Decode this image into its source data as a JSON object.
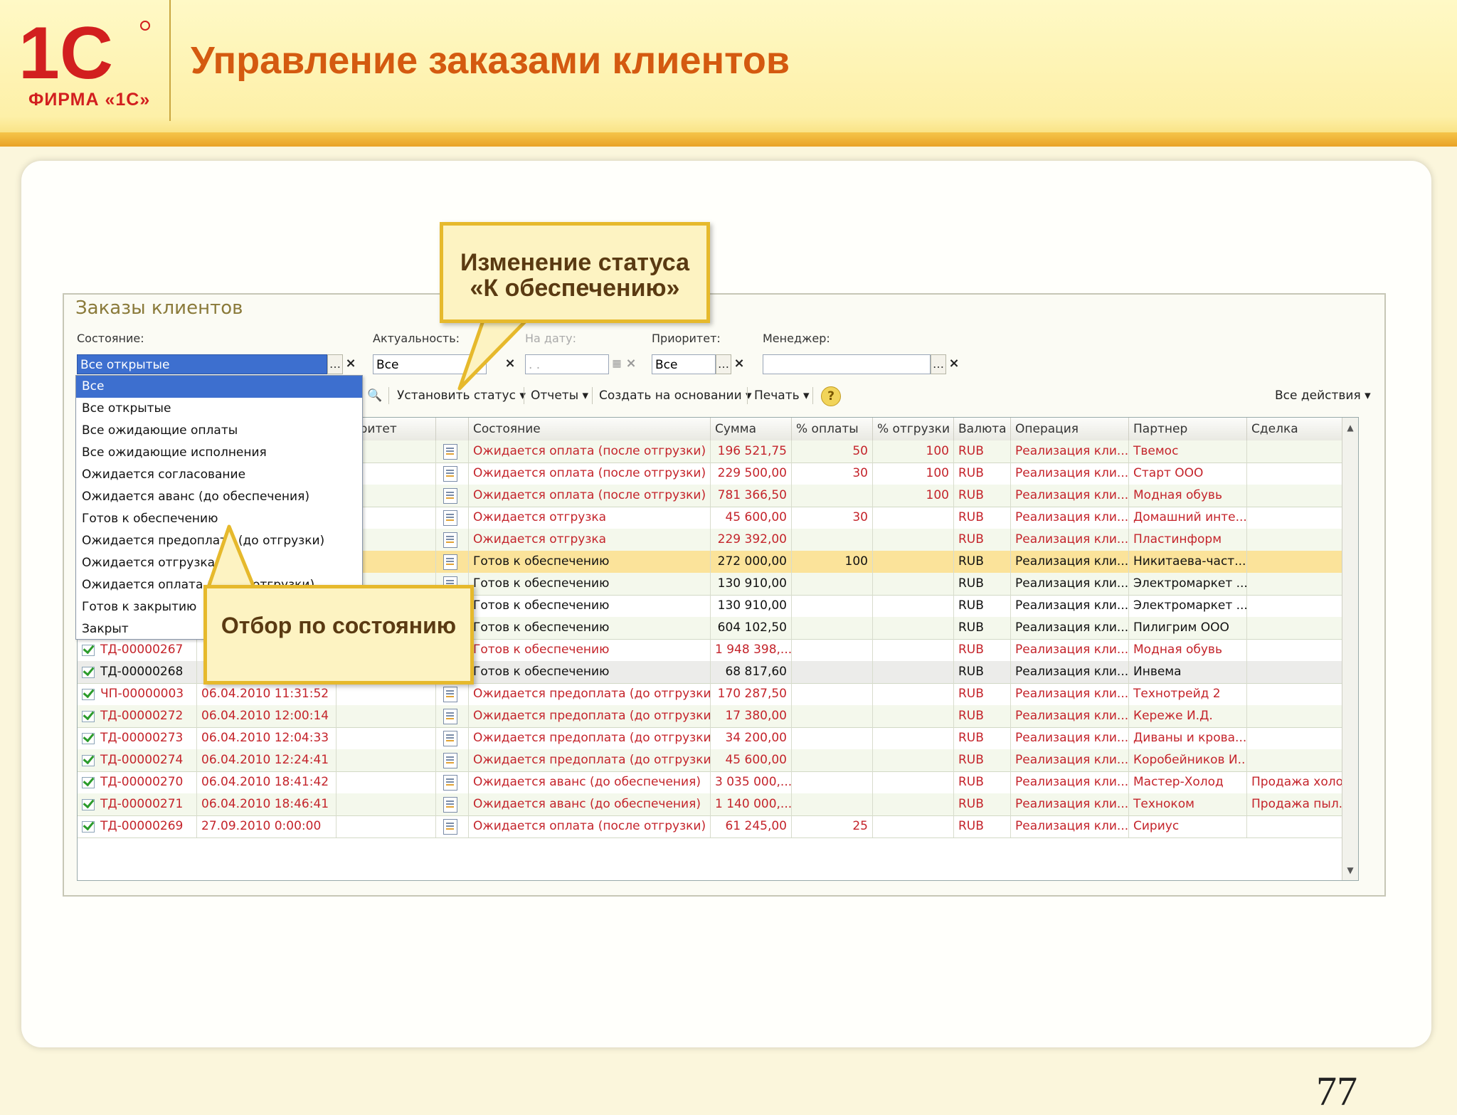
{
  "slide": {
    "title": "Управление заказами клиентов",
    "logo_text": "ФИРМА «1С»",
    "logo_mark": "1С",
    "page_number": "77",
    "accent_color": "#d45a10",
    "brand_color": "#d21f1f"
  },
  "window": {
    "title": "Заказы клиентов",
    "filters": {
      "state_label": "Состояние:",
      "state_value": "Все открытые",
      "relevance_label": "Актуальность:",
      "relevance_value": "Все",
      "date_label": "На дату:",
      "date_placeholder": ". .",
      "priority_label": "Приоритет:",
      "priority_value": "Все",
      "manager_label": "Менеджер:",
      "manager_value": ""
    },
    "toolbar": {
      "set_status": "Установить статус ▾",
      "reports": "Отчеты ▾",
      "create_based": "Создать на основании ▾",
      "print": "Печать ▾",
      "help": "?",
      "all_actions": "Все действия ▾"
    },
    "columns": [
      "",
      "",
      "...оритет",
      "",
      "Состояние",
      "Сумма",
      "% оплаты",
      "% отгрузки",
      "Валюта",
      "Операция",
      "Партнер",
      "Сделка"
    ],
    "rows": [
      {
        "num": "",
        "date": "",
        "state": "Ожидается оплата (после отгрузки)",
        "sum": "196 521,75",
        "pay": "50",
        "ship": "100",
        "cur": "RUB",
        "op": "Реализация кли...",
        "partner": "Твемос",
        "deal": "",
        "color": "red"
      },
      {
        "num": "",
        "date": "",
        "state": "Ожидается оплата (после отгрузки)",
        "sum": "229 500,00",
        "pay": "30",
        "ship": "100",
        "cur": "RUB",
        "op": "Реализация кли...",
        "partner": "Старт ООО",
        "deal": "",
        "color": "red"
      },
      {
        "num": "",
        "date": "",
        "state": "Ожидается оплата (после отгрузки)",
        "sum": "781 366,50",
        "pay": "",
        "ship": "100",
        "cur": "RUB",
        "op": "Реализация кли...",
        "partner": "Модная обувь",
        "deal": "",
        "color": "red"
      },
      {
        "num": "",
        "date": "",
        "state": "Ожидается отгрузка",
        "sum": "45 600,00",
        "pay": "30",
        "ship": "",
        "cur": "RUB",
        "op": "Реализация кли...",
        "partner": "Домашний инте...",
        "deal": "",
        "color": "red"
      },
      {
        "num": "",
        "date": "",
        "state": "Ожидается отгрузка",
        "sum": "229 392,00",
        "pay": "",
        "ship": "",
        "cur": "RUB",
        "op": "Реализация кли...",
        "partner": "Пластинформ",
        "deal": "",
        "color": "red"
      },
      {
        "num": "",
        "date": "",
        "state": "Готов к обеспечению",
        "sum": "272 000,00",
        "pay": "100",
        "ship": "",
        "cur": "RUB",
        "op": "Реализация кли...",
        "partner": "Никитаева-част...",
        "deal": "",
        "color": "black"
      },
      {
        "num": "",
        "date": "",
        "state": "Готов к обеспечению",
        "sum": "130 910,00",
        "pay": "",
        "ship": "",
        "cur": "RUB",
        "op": "Реализация кли...",
        "partner": "Электромаркет ...",
        "deal": "",
        "color": "black"
      },
      {
        "num": "",
        "date": "",
        "state": "Готов к обеспечению",
        "sum": "130 910,00",
        "pay": "",
        "ship": "",
        "cur": "RUB",
        "op": "Реализация кли...",
        "partner": "Электромаркет ...",
        "deal": "",
        "color": "black"
      },
      {
        "num": "",
        "date": "",
        "state": "Готов к обеспечению",
        "sum": "604 102,50",
        "pay": "",
        "ship": "",
        "cur": "RUB",
        "op": "Реализация кли...",
        "partner": "Пилигрим ООО",
        "deal": "",
        "color": "black"
      },
      {
        "num": "ТД-00000267",
        "date": "",
        "state": "Готов к обеспечению",
        "sum": "1 948 398,...",
        "pay": "",
        "ship": "",
        "cur": "RUB",
        "op": "Реализация кли...",
        "partner": "Модная обувь",
        "deal": "",
        "color": "red"
      },
      {
        "num": "ТД-00000268",
        "date": "",
        "state": "Готов к обеспечению",
        "sum": "68 817,60",
        "pay": "",
        "ship": "",
        "cur": "RUB",
        "op": "Реализация кли...",
        "partner": "Инвема",
        "deal": "",
        "color": "black"
      },
      {
        "num": "ЧП-00000003",
        "date": "06.04.2010 11:31:52",
        "state": "Ожидается предоплата (до отгрузки)",
        "sum": "170 287,50",
        "pay": "",
        "ship": "",
        "cur": "RUB",
        "op": "Реализация кли...",
        "partner": "Технотрейд 2",
        "deal": "",
        "color": "red"
      },
      {
        "num": "ТД-00000272",
        "date": "06.04.2010 12:00:14",
        "state": "Ожидается предоплата (до отгрузки)",
        "sum": "17 380,00",
        "pay": "",
        "ship": "",
        "cur": "RUB",
        "op": "Реализация кли...",
        "partner": "Кереже И.Д.",
        "deal": "",
        "color": "red"
      },
      {
        "num": "ТД-00000273",
        "date": "06.04.2010 12:04:33",
        "state": "Ожидается предоплата (до отгрузки)",
        "sum": "34 200,00",
        "pay": "",
        "ship": "",
        "cur": "RUB",
        "op": "Реализация кли...",
        "partner": "Диваны и крова...",
        "deal": "",
        "color": "red"
      },
      {
        "num": "ТД-00000274",
        "date": "06.04.2010 12:24:41",
        "state": "Ожидается предоплата (до отгрузки)",
        "sum": "45 600,00",
        "pay": "",
        "ship": "",
        "cur": "RUB",
        "op": "Реализация кли...",
        "partner": "Коробейников И...",
        "deal": "",
        "color": "red"
      },
      {
        "num": "ТД-00000270",
        "date": "06.04.2010 18:41:42",
        "state": "Ожидается аванс (до обеспечения)",
        "sum": "3 035 000,...",
        "pay": "",
        "ship": "",
        "cur": "RUB",
        "op": "Реализация кли...",
        "partner": "Мастер-Холод",
        "deal": "Продажа холо...",
        "color": "red"
      },
      {
        "num": "ТД-00000271",
        "date": "06.04.2010 18:46:41",
        "state": "Ожидается аванс (до обеспечения)",
        "sum": "1 140 000,...",
        "pay": "",
        "ship": "",
        "cur": "RUB",
        "op": "Реализация кли...",
        "partner": "Техноком",
        "deal": "Продажа пыл...",
        "color": "red"
      },
      {
        "num": "ТД-00000269",
        "date": "27.09.2010 0:00:00",
        "state": "Ожидается оплата (после отгрузки)",
        "sum": "61 245,00",
        "pay": "25",
        "ship": "",
        "cur": "RUB",
        "op": "Реализация кли...",
        "partner": "Сириус",
        "deal": "",
        "color": "red"
      }
    ],
    "dropdown_items": [
      "Все",
      "Все открытые",
      "Все ожидающие оплаты",
      "Все ожидающие исполнения",
      "Ожидается согласование",
      "Ожидается аванс (до обеспечения)",
      "Готов к обеспечению",
      "Ожидается предоплата (до отгрузки)",
      "Ожидается отгрузка",
      "Ожидается оплата (после отгрузки)",
      "Готов к закрытию",
      "Закрыт"
    ]
  },
  "callouts": {
    "status_change": "Изменение статуса «К обеспечению»",
    "filter_by_state": "Отбор по состоянию"
  }
}
